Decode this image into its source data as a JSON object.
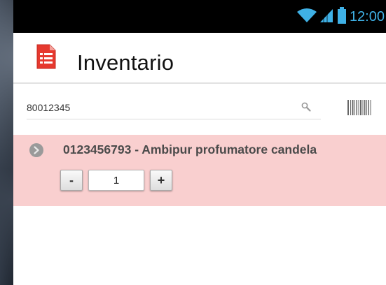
{
  "status_bar": {
    "time": "12:00",
    "icons": [
      "wifi-icon",
      "signal-icon",
      "battery-icon"
    ],
    "accent_color": "#3fb1e6"
  },
  "app_bar": {
    "title": "Inventario",
    "icon": "document-list-icon",
    "icon_color": "#d9342b"
  },
  "search": {
    "value": "80012345",
    "icon": "search-icon",
    "barcode_icon": "barcode-icon"
  },
  "items": [
    {
      "title": "0123456793 - Ambipur profumatore candela",
      "quantity": "1",
      "decrement_label": "-",
      "increment_label": "+",
      "highlight_color": "#f9cfcf"
    }
  ]
}
